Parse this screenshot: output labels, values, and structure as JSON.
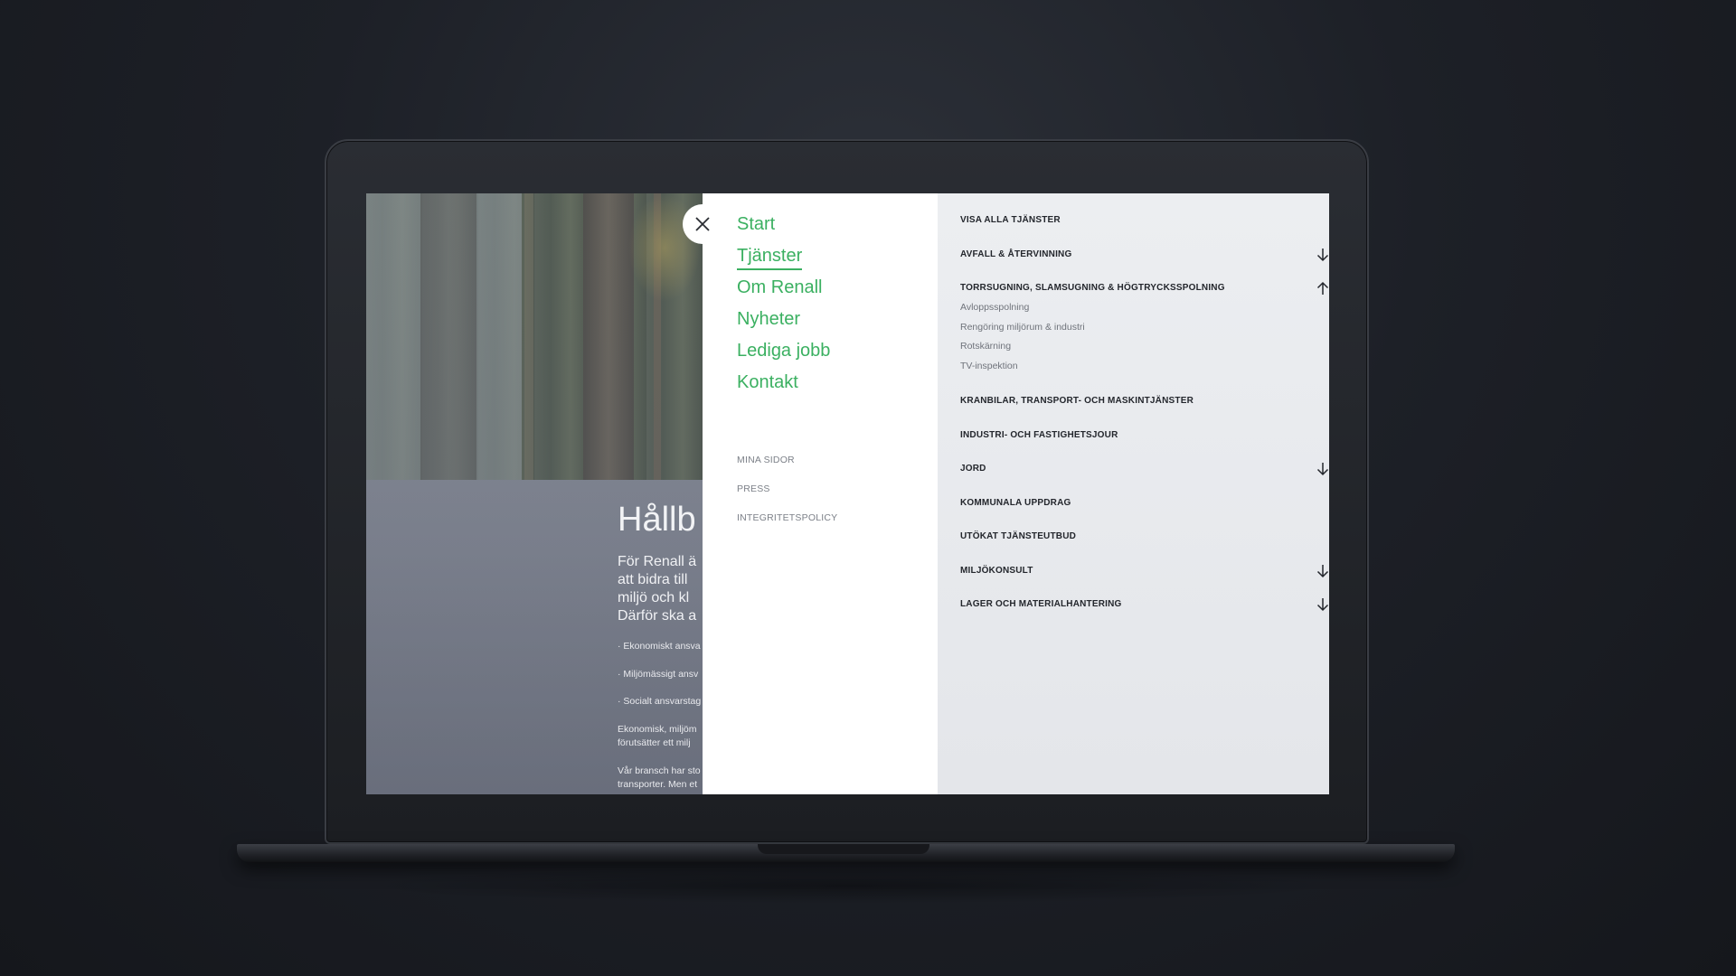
{
  "close_icon": "close-icon",
  "page": {
    "heading": "Hållb",
    "lead": [
      "För Renall ä",
      "att bidra till",
      "miljö och kl",
      "Därför ska a"
    ],
    "bullets": [
      "· Ekonomiskt ansva",
      "· Miljömässigt ansv",
      "· Socialt ansvarstag"
    ],
    "para1": [
      "Ekonomisk, miljöm",
      "förutsätter ett milj"
    ],
    "para2": [
      "Vår bransch har sto",
      "transporter. Men et"
    ]
  },
  "primary_nav": {
    "items": [
      {
        "label": "Start",
        "active": false
      },
      {
        "label": "Tjänster",
        "active": true
      },
      {
        "label": "Om Renall",
        "active": false
      },
      {
        "label": "Nyheter",
        "active": false
      },
      {
        "label": "Lediga jobb",
        "active": false
      },
      {
        "label": "Kontakt",
        "active": false
      }
    ]
  },
  "secondary_nav": {
    "items": [
      "MINA SIDOR",
      "PRESS",
      "INTEGRITETSPOLICY"
    ]
  },
  "services": {
    "items": [
      {
        "label": "VISA ALLA TJÄNSTER",
        "arrow": ""
      },
      {
        "label": "AVFALL & ÅTERVINNING",
        "arrow": "arrow-down-icon"
      },
      {
        "label": "TORRSUGNING, SLAMSUGNING & HÖGTRYCKSSPOLNING",
        "arrow": "arrow-up-icon",
        "children": [
          "Avloppsspolning",
          "Rengöring miljörum & industri",
          "Rotskärning",
          "TV-inspektion"
        ]
      },
      {
        "label": "KRANBILAR, TRANSPORT- OCH MASKINTJÄNSTER",
        "arrow": ""
      },
      {
        "label": "INDUSTRI- OCH FASTIGHETSJOUR",
        "arrow": ""
      },
      {
        "label": "JORD",
        "arrow": "arrow-down-icon"
      },
      {
        "label": "KOMMUNALA UPPDRAG",
        "arrow": ""
      },
      {
        "label": "UTÖKAT TJÄNSTEUTBUD",
        "arrow": ""
      },
      {
        "label": "MILJÖKONSULT",
        "arrow": "arrow-down-icon"
      },
      {
        "label": "LAGER OCH MATERIALHANTERING",
        "arrow": "arrow-down-icon"
      }
    ]
  },
  "colors": {
    "accent": "#3bb061",
    "menu_bg": "#ffffff",
    "services_bg": "#eceef1",
    "text_dark": "#23262c"
  }
}
